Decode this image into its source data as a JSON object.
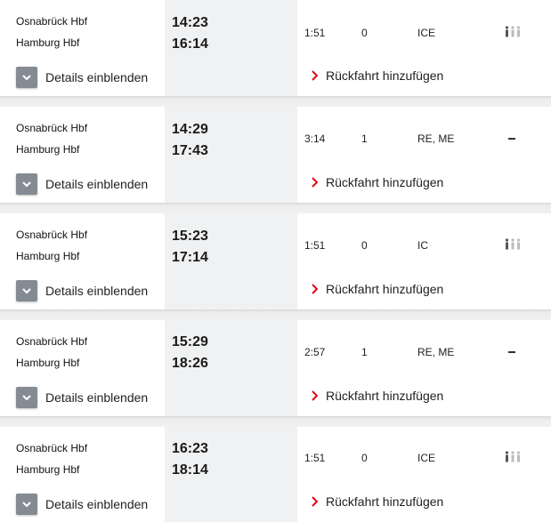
{
  "connections": [
    {
      "from": "Osnabrück Hbf",
      "to": "Hamburg Hbf",
      "dep": "14:23",
      "arr": "16:14",
      "duration": "1:51",
      "changes": "0",
      "products": "ICE",
      "occupancy": "occupancy-icon",
      "details_label": "Details einblenden",
      "return_label": "Rückfahrt hinzufügen"
    },
    {
      "from": "Osnabrück Hbf",
      "to": "Hamburg Hbf",
      "dep": "14:29",
      "arr": "17:43",
      "duration": "3:14",
      "changes": "1",
      "products": "RE, ME",
      "occupancy": "none",
      "details_label": "Details einblenden",
      "return_label": "Rückfahrt hinzufügen"
    },
    {
      "from": "Osnabrück Hbf",
      "to": "Hamburg Hbf",
      "dep": "15:23",
      "arr": "17:14",
      "duration": "1:51",
      "changes": "0",
      "products": "IC",
      "occupancy": "occupancy-icon",
      "details_label": "Details einblenden",
      "return_label": "Rückfahrt hinzufügen"
    },
    {
      "from": "Osnabrück Hbf",
      "to": "Hamburg Hbf",
      "dep": "15:29",
      "arr": "18:26",
      "duration": "2:57",
      "changes": "1",
      "products": "RE, ME",
      "occupancy": "none",
      "details_label": "Details einblenden",
      "return_label": "Rückfahrt hinzufügen"
    },
    {
      "from": "Osnabrück Hbf",
      "to": "Hamburg Hbf",
      "dep": "16:23",
      "arr": "18:14",
      "duration": "1:51",
      "changes": "0",
      "products": "ICE",
      "occupancy": "occupancy-icon",
      "details_label": "Details einblenden",
      "return_label": "Rückfahrt hinzufügen"
    }
  ],
  "colors": {
    "accent": "#ec0016",
    "panel": "#f0f1f2",
    "chevron_box": "#858b94"
  }
}
